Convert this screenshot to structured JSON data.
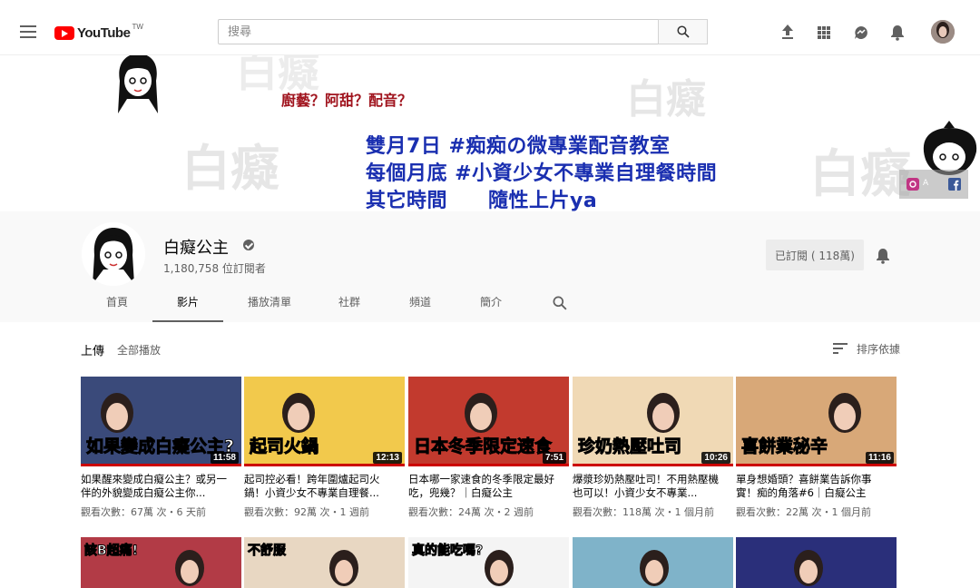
{
  "masthead": {
    "logo_text": "YouTube",
    "region": "TW",
    "search_placeholder": "搜尋"
  },
  "banner": {
    "question": "廚藝？阿甜？配音？",
    "lines": [
      "雙月7日 #痴痴の微專業配音教室",
      "每個月底 #小資少女不專業自理餐時間",
      "其它時間　　隨性上片ya"
    ],
    "watermark": "白癡"
  },
  "channel": {
    "name": "白癡公主",
    "subscribers": "1,180,758 位訂閱者",
    "subscribe_button": "已訂閱 ( 118萬)"
  },
  "tabs": [
    "首頁",
    "影片",
    "播放清單",
    "社群",
    "頻道",
    "簡介"
  ],
  "section": {
    "title": "上傳",
    "play_all": "全部播放",
    "sort": "排序依據"
  },
  "videos": [
    {
      "title": "如果醒來變成白癡公主？或另一伴的外貌變成白癡公主你...",
      "meta": "觀看次數：67萬 次・6 天前",
      "duration": "11:58",
      "thumb_text": "如果變成白癡公主?",
      "thumb_color": "#3a4a7a"
    },
    {
      "title": "起司控必看！跨年圍爐起司火鍋！小資少女不專業自理餐...",
      "meta": "觀看次數：92萬 次・1 週前",
      "duration": "12:13",
      "thumb_text": "起司火鍋",
      "thumb_color": "#f2c94c"
    },
    {
      "title": "日本哪一家速食的冬季限定最好吃，兜幾？｜白癡公主",
      "meta": "觀看次數：24萬 次・2 週前",
      "duration": "7:51",
      "thumb_text": "日本冬季限定速食",
      "thumb_color": "#c23a2e"
    },
    {
      "title": "爆漿珍奶熱壓吐司！不用熱壓機也可以！小資少女不專業...",
      "meta": "觀看次數：118萬 次・1 個月前",
      "duration": "10:26",
      "thumb_text": "珍奶熱壓吐司",
      "thumb_color": "#f0d9b5"
    },
    {
      "title": "單身想婚頭？喜餅業告訴你事實！痴的角落#6｜白癡公主",
      "meta": "觀看次數：22萬 次・1 個月前",
      "duration": "11:16",
      "thumb_text": "喜餅業秘辛",
      "thumb_color": "#d8a878"
    }
  ],
  "videos_row2": [
    {
      "thumb_text": "該B超痛!",
      "thumb_color": "#b23b46"
    },
    {
      "thumb_text": "不舒服",
      "thumb_color": "#e8d7c2"
    },
    {
      "thumb_text": "真的能吃嗎?",
      "thumb_color": "#f4f4f4"
    },
    {
      "thumb_text": "",
      "thumb_color": "#7fb3c9"
    },
    {
      "thumb_text": "",
      "thumb_color": "#2a2f7a"
    }
  ]
}
